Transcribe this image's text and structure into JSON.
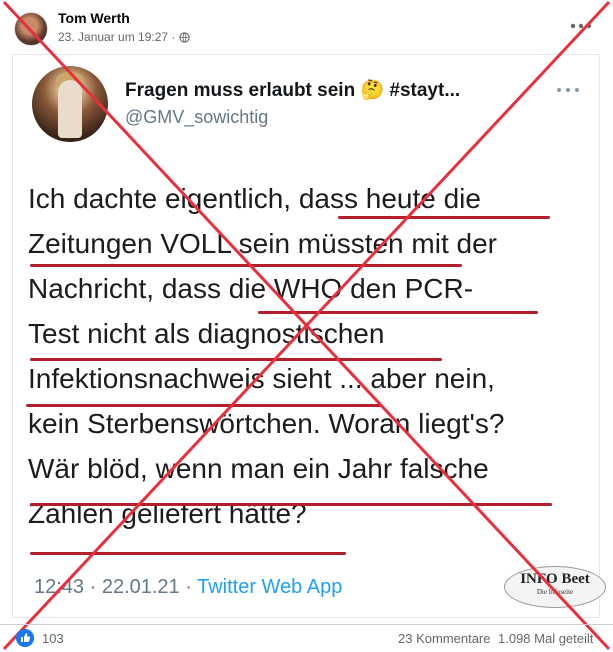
{
  "post": {
    "author": "Tom Werth",
    "date": "23. Januar um 19:27 ·",
    "privacy_icon": "globe-icon"
  },
  "tweet": {
    "display_name": "Fragen muss erlaubt sein 🤔 #stayt...",
    "handle": "@GMV_sowichtig",
    "text_lines": [
      "Ich dachte eigentlich, dass heute die",
      "Zeitungen VOLL sein müssten mit der",
      "Nachricht, dass die WHO den PCR-",
      "Test nicht als diagnostischen",
      "Infektionsnachweis sieht ... aber nein,",
      "kein Sterbenswörtchen. Woran liegt's?",
      "Wär blöd, wenn man ein Jahr falsche",
      "Zahlen geliefert hätte?"
    ],
    "time_date": "12:43 · 22.01.21 · ",
    "source": "Twitter Web App"
  },
  "watermark": {
    "logo": "INFO Beet",
    "subtitle": "Die Infoseite"
  },
  "stats": {
    "likes": "103",
    "comments": "23 Kommentare",
    "shares": "1.098 Mal geteilt"
  },
  "colors": {
    "cross": "#e8303c",
    "underline": "#b3202b",
    "facebook_blue": "#1877f2"
  }
}
